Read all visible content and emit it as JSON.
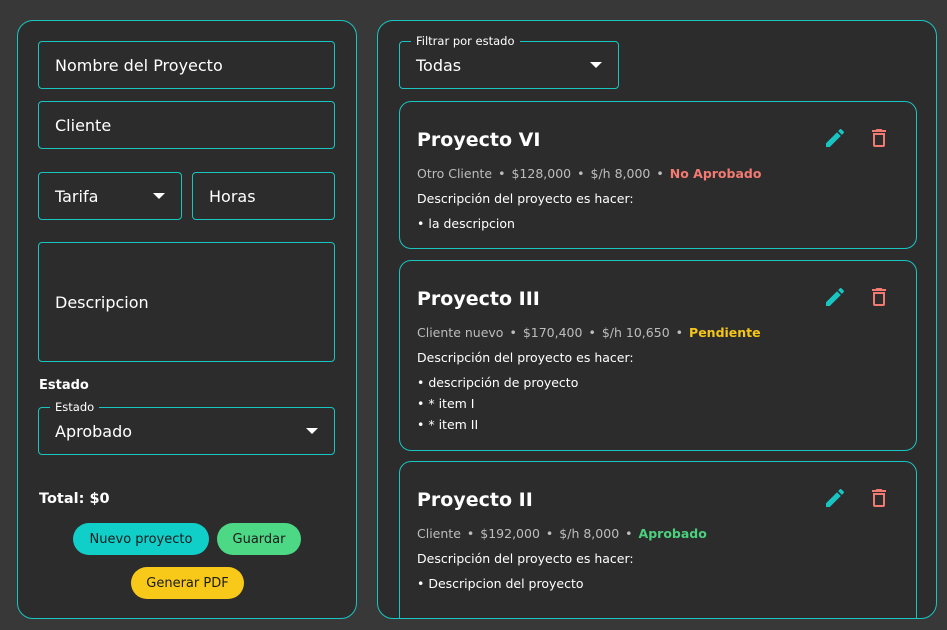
{
  "form": {
    "nombre_placeholder": "Nombre del Proyecto",
    "cliente_placeholder": "Cliente",
    "tarifa_label": "Tarifa",
    "horas_placeholder": "Horas",
    "descripcion_placeholder": "Descripcion",
    "estado_section": "Estado",
    "estado_field_label": "Estado",
    "estado_value": "Aprobado",
    "total": "Total: $0",
    "buttons": {
      "nuevo": "Nuevo proyecto",
      "guardar": "Guardar",
      "pdf": "Generar PDF"
    }
  },
  "filter": {
    "label": "Filtrar por estado",
    "value": "Todas"
  },
  "projects": [
    {
      "title": "Proyecto VI",
      "client": "Otro Cliente",
      "amount": "$128,000",
      "rate": "$/h 8,000",
      "status": "No Aprobado",
      "desc": "Descripción del proyecto es hacer:",
      "items": [
        "• la descripcion"
      ]
    },
    {
      "title": "Proyecto III",
      "client": "Cliente nuevo",
      "amount": "$170,400",
      "rate": "$/h 10,650",
      "status": "Pendiente",
      "desc": "Descripción del proyecto es hacer:",
      "items": [
        "• descripción de proyecto",
        "• * item I",
        "• * item II"
      ]
    },
    {
      "title": "Proyecto II",
      "client": "Cliente",
      "amount": "$192,000",
      "rate": "$/h 8,000",
      "status": "Aprobado",
      "desc": "Descripción del proyecto es hacer:",
      "items": [
        "• Descripcion del proyecto"
      ]
    }
  ],
  "colors": {
    "accent": "#19c5c1",
    "status_no_aprobado": "#f27a72",
    "status_pendiente": "#f5c518",
    "status_aprobado": "#4cd07d",
    "btn_nuevo": "#10cfc8",
    "btn_guardar": "#4cd884",
    "btn_pdf": "#f8c919"
  },
  "icons": {
    "edit": "pencil-icon",
    "delete": "trash-icon"
  }
}
